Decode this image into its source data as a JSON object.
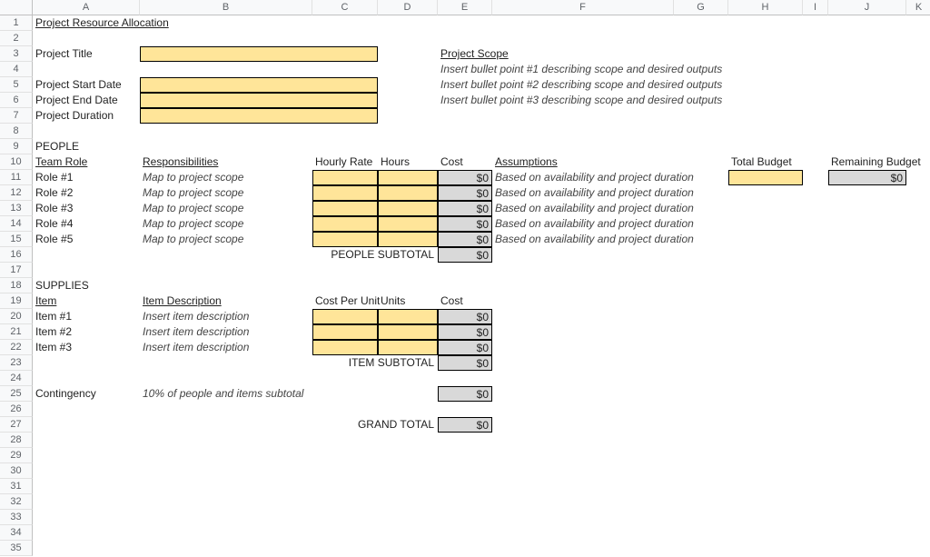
{
  "columns": [
    "A",
    "B",
    "C",
    "D",
    "E",
    "F",
    "G",
    "H",
    "I",
    "J",
    "K"
  ],
  "row_count": 35,
  "title": "Project Resource Allocation",
  "labels": {
    "project_title": "Project Title",
    "project_start": "Project Start Date",
    "project_end": "Project End Date",
    "project_duration": "Project Duration",
    "project_scope": "Project Scope",
    "people": "PEOPLE",
    "team_role": "Team Role",
    "responsibilities": "Responsibilities",
    "hourly_rate": "Hourly Rate",
    "hours": "Hours",
    "cost": "Cost",
    "assumptions": "Assumptions",
    "total_budget": "Total Budget",
    "remaining_budget": "Remaining Budget",
    "people_subtotal": "PEOPLE SUBTOTAL",
    "supplies": "SUPPLIES",
    "item": "Item",
    "item_description": "Item Description",
    "cost_per_unit": "Cost Per Unit",
    "units": "Units",
    "item_subtotal": "ITEM SUBTOTAL",
    "contingency": "Contingency",
    "contingency_desc": "10% of people and items subtotal",
    "grand_total": "GRAND TOTAL"
  },
  "scope_bullets": [
    "Insert bullet point #1 describing scope and desired outputs",
    "Insert bullet point #2 describing scope and desired outputs",
    "Insert bullet point #3 describing scope and desired outputs"
  ],
  "people_rows": [
    {
      "role": "Role #1",
      "resp": "Map to project scope",
      "cost": "$0",
      "assump": "Based on availability and project duration"
    },
    {
      "role": "Role #2",
      "resp": "Map to project scope",
      "cost": "$0",
      "assump": "Based on availability and project duration"
    },
    {
      "role": "Role #3",
      "resp": "Map to project scope",
      "cost": "$0",
      "assump": "Based on availability and project duration"
    },
    {
      "role": "Role #4",
      "resp": "Map to project scope",
      "cost": "$0",
      "assump": "Based on availability and project duration"
    },
    {
      "role": "Role #5",
      "resp": "Map to project scope",
      "cost": "$0",
      "assump": "Based on availability and project duration"
    }
  ],
  "people_subtotal_val": "$0",
  "supply_rows": [
    {
      "item": "Item #1",
      "desc": "Insert item description",
      "cost": "$0"
    },
    {
      "item": "Item #2",
      "desc": "Insert item description",
      "cost": "$0"
    },
    {
      "item": "Item #3",
      "desc": "Insert item description",
      "cost": "$0"
    }
  ],
  "item_subtotal_val": "$0",
  "contingency_val": "$0",
  "grand_total_val": "$0",
  "remaining_budget_val": "$0"
}
